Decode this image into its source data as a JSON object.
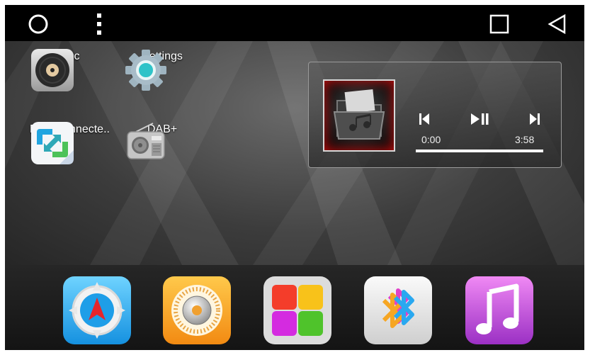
{
  "nav": {
    "home_icon": "circle-home-icon",
    "menu_icon": "vertical-dots-icon",
    "recents_icon": "square-recents-icon",
    "back_icon": "triangle-back-icon"
  },
  "desktop": {
    "apps": [
      {
        "label": "Disc",
        "icon": "disc-icon"
      },
      {
        "label": "Settings",
        "icon": "gear-icon"
      },
      {
        "label": "EasyConnecte..",
        "icon": "easyconnect-icon"
      },
      {
        "label": "DAB+",
        "icon": "radio-icon"
      }
    ]
  },
  "music_widget": {
    "album_art_icon": "music-folder-icon",
    "prev_icon": "skip-previous-icon",
    "playpause_icon": "play-pause-icon",
    "next_icon": "skip-next-icon",
    "time_current": "0:00",
    "time_total": "3:58",
    "progress": 0.0
  },
  "dock": {
    "apps": [
      {
        "icon": "navigation-compass-icon",
        "color": "#22a6f2"
      },
      {
        "icon": "radio-tuner-icon",
        "color": "#f7a21b"
      },
      {
        "icon": "four-color-tiles-icon",
        "color": "#d8d8d8"
      },
      {
        "icon": "bluetooth-icon",
        "color": "#e6e6e6"
      },
      {
        "icon": "music-note-icon",
        "color": "#b63fcf"
      }
    ]
  },
  "colors": {
    "background": "#000000",
    "wallpaper": "#3c3c3c",
    "accent_red": "#d01010"
  }
}
